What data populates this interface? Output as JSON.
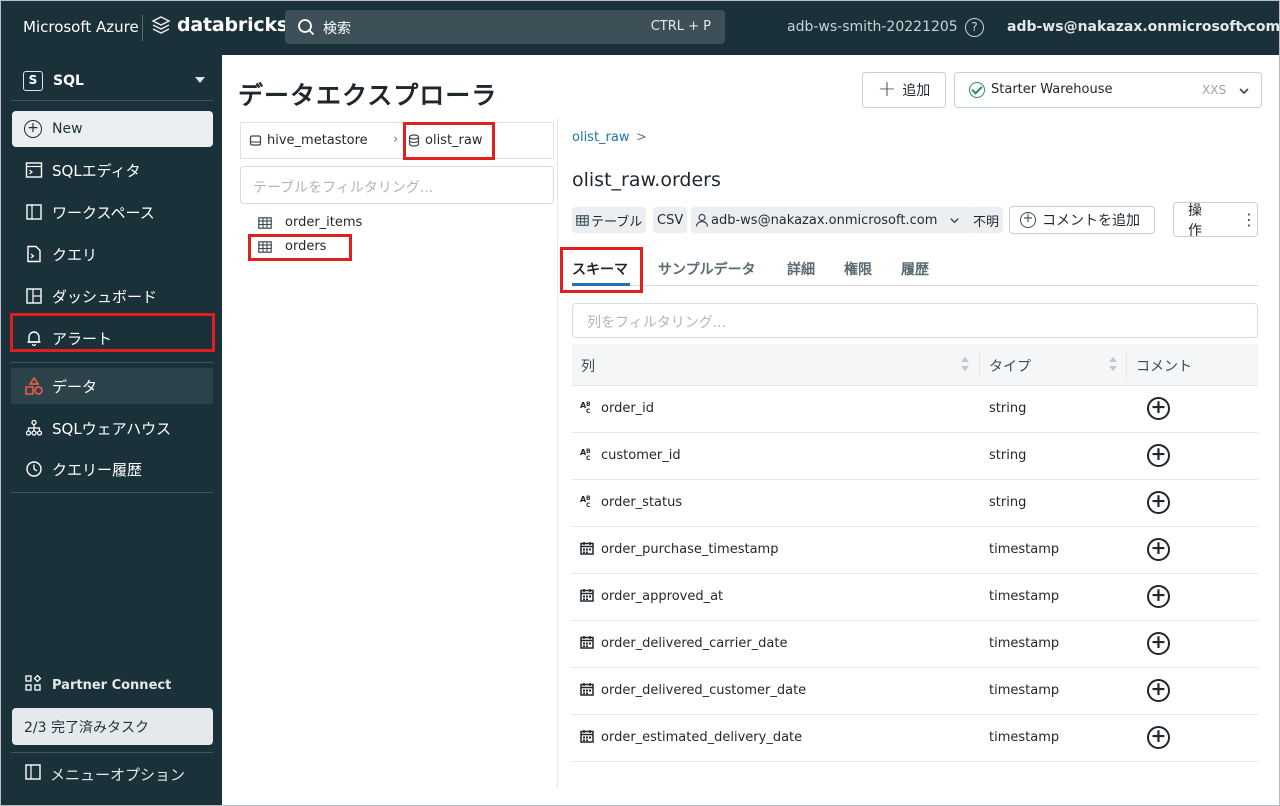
{
  "topbar": {
    "brand_azure": "Microsoft Azure",
    "brand_databricks": "databricks",
    "search_placeholder": "検索",
    "search_shortcut": "CTRL + P",
    "workspace": "adb-ws-smith-20221205",
    "help_icon": "?",
    "user": "adb-ws@nakazax.onmicrosoft.com"
  },
  "sidebar": {
    "persona_badge": "S",
    "persona_label": "SQL",
    "new_label": "New",
    "items": [
      {
        "label": "SQLエディタ",
        "icon": "sql-editor-icon"
      },
      {
        "label": "ワークスペース",
        "icon": "workspace-icon"
      },
      {
        "label": "クエリ",
        "icon": "query-icon"
      },
      {
        "label": "ダッシュボード",
        "icon": "dashboard-icon"
      },
      {
        "label": "アラート",
        "icon": "bell-icon"
      },
      {
        "label": "データ",
        "icon": "data-icon"
      },
      {
        "label": "SQLウェアハウス",
        "icon": "warehouse-icon"
      },
      {
        "label": "クエリー履歴",
        "icon": "history-icon"
      }
    ],
    "partner_connect": "Partner Connect",
    "tasks": "2/3 完了済みタスク",
    "menu_options": "メニューオプション"
  },
  "page": {
    "title": "データエクスプローラ",
    "add_button": "追加",
    "warehouse": {
      "name": "Starter Warehouse",
      "size": "XXS",
      "status_color": "#2e8b57"
    }
  },
  "explorer": {
    "catalog": "hive_metastore",
    "schema": "olist_raw",
    "table_filter_placeholder": "テーブルをフィルタリング...",
    "tables": [
      "order_items",
      "orders"
    ]
  },
  "detail": {
    "breadcrumb": "olist_raw",
    "breadcrumb_arrow": ">",
    "title": "olist_raw.orders",
    "tags": {
      "type": "テーブル",
      "format": "CSV",
      "owner": "adb-ws@nakazax.onmicrosoft.com",
      "size": "不明"
    },
    "add_comment": "コメントを追加",
    "operations": "操作",
    "tabs": [
      "スキーマ",
      "サンプルデータ",
      "詳細",
      "権限",
      "履歴"
    ],
    "column_filter_placeholder": "列をフィルタリング...",
    "headers": {
      "column": "列",
      "type": "タイプ",
      "comment": "コメント"
    },
    "columns": [
      {
        "name": "order_id",
        "type": "string"
      },
      {
        "name": "customer_id",
        "type": "string"
      },
      {
        "name": "order_status",
        "type": "string"
      },
      {
        "name": "order_purchase_timestamp",
        "type": "timestamp"
      },
      {
        "name": "order_approved_at",
        "type": "timestamp"
      },
      {
        "name": "order_delivered_carrier_date",
        "type": "timestamp"
      },
      {
        "name": "order_delivered_customer_date",
        "type": "timestamp"
      },
      {
        "name": "order_estimated_delivery_date",
        "type": "timestamp"
      }
    ]
  },
  "colors": {
    "accent": "#2272b4",
    "navy": "#1b3139",
    "highlight": "#e21f1f"
  }
}
